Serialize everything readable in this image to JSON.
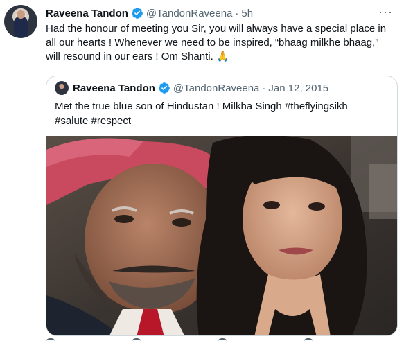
{
  "tweet": {
    "author_name": "Raveena Tandon",
    "author_handle": "@TandonRaveena",
    "separator": "·",
    "time": "5h",
    "more_label": "···",
    "text": "Had the honour of meeting you Sir, you will always have a special place in all our hearts ! Whenever we need to be inspired, “bhaag milkhe bhaag,” will resound in our ears ! Om Shanti. 🙏",
    "avatar_icon": "user-avatar",
    "verified_icon": "verified-badge-icon"
  },
  "quoted_tweet": {
    "author_name": "Raveena Tandon",
    "author_handle": "@TandonRaveena",
    "separator": "·",
    "date": "Jan 12, 2015",
    "text": "Met the true blue son of Hindustan ! Milkha Singh #theflyingsikh #salute #respect",
    "media_icon": "selfie-photo"
  },
  "colors": {
    "verified": "#1d9bf0",
    "text_primary": "#0f1419",
    "text_secondary": "#536471",
    "border": "#cfd9de"
  },
  "actions": [
    "reply-icon",
    "retweet-icon",
    "like-icon",
    "share-icon"
  ]
}
